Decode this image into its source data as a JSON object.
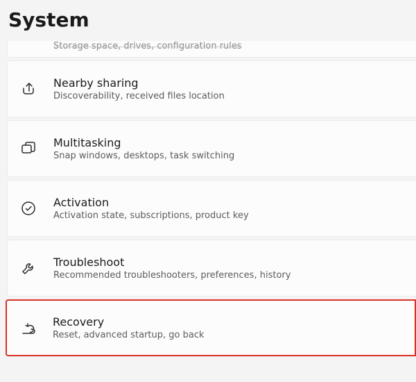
{
  "header": {
    "title": "System"
  },
  "items": [
    {
      "key": "storage",
      "title": "",
      "subtitle": "Storage space, drives, configuration rules",
      "icon": "storage-icon",
      "partial": true
    },
    {
      "key": "nearby-sharing",
      "title": "Nearby sharing",
      "subtitle": "Discoverability, received files location",
      "icon": "share-icon"
    },
    {
      "key": "multitasking",
      "title": "Multitasking",
      "subtitle": "Snap windows, desktops, task switching",
      "icon": "multitasking-icon"
    },
    {
      "key": "activation",
      "title": "Activation",
      "subtitle": "Activation state, subscriptions, product key",
      "icon": "check-circle-icon"
    },
    {
      "key": "troubleshoot",
      "title": "Troubleshoot",
      "subtitle": "Recommended troubleshooters, preferences, history",
      "icon": "wrench-icon"
    },
    {
      "key": "recovery",
      "title": "Recovery",
      "subtitle": "Reset, advanced startup, go back",
      "icon": "recovery-icon",
      "highlight": true
    }
  ]
}
